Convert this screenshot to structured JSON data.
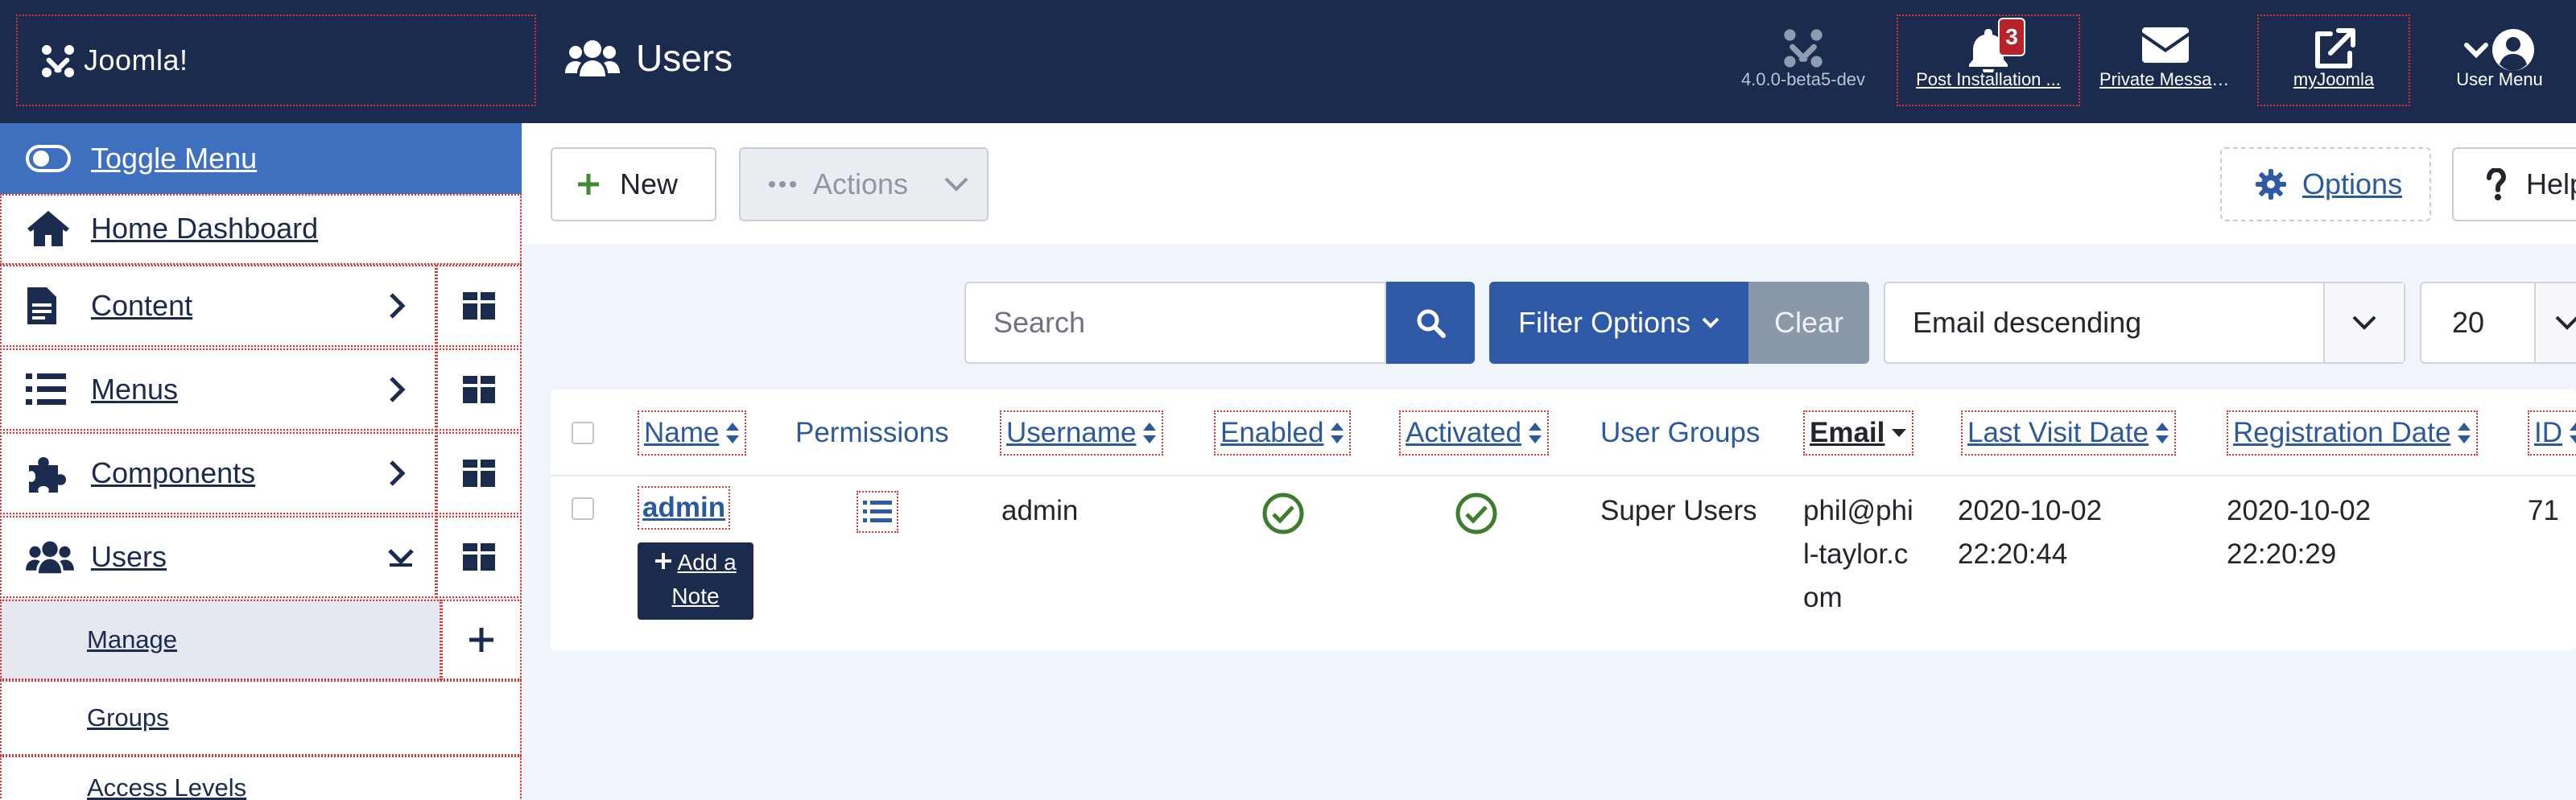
{
  "header": {
    "logo_text": "Joomla!",
    "title": "Users",
    "version": "4.0.0-beta5-dev",
    "post_install_label": "Post Installation ...",
    "post_install_count": "3",
    "private_messages_label": "Private Messages",
    "myjoomla_label": "myJoomla",
    "user_menu_label": "User Menu"
  },
  "sidebar": {
    "toggle_label": "Toggle Menu",
    "items": [
      {
        "label": "Home Dashboard"
      },
      {
        "label": "Content"
      },
      {
        "label": "Menus"
      },
      {
        "label": "Components"
      },
      {
        "label": "Users"
      }
    ],
    "sub_items": [
      {
        "label": "Manage"
      },
      {
        "label": "Groups"
      },
      {
        "label": "Access Levels"
      }
    ]
  },
  "toolbar": {
    "new_label": "New",
    "actions_label": "Actions",
    "options_label": "Options",
    "help_label": "Help"
  },
  "filters": {
    "search_placeholder": "Search",
    "filter_options_label": "Filter Options",
    "clear_label": "Clear",
    "sort_value": "Email descending",
    "limit_value": "20"
  },
  "table": {
    "columns": {
      "name": "Name",
      "permissions": "Permissions",
      "username": "Username",
      "enabled": "Enabled",
      "activated": "Activated",
      "user_groups": "User Groups",
      "email": "Email",
      "last_visit": "Last Visit Date",
      "registration": "Registration Date",
      "id": "ID"
    },
    "rows": [
      {
        "name": "admin",
        "add_note": "Add a Note",
        "username": "admin",
        "user_groups": "Super Users",
        "email": "phil@phil-taylor.com",
        "last_visit_date": "2020-10-02",
        "last_visit_time": "22:20:44",
        "registration_date": "2020-10-02",
        "registration_time": "22:20:29",
        "id": "71"
      }
    ]
  }
}
